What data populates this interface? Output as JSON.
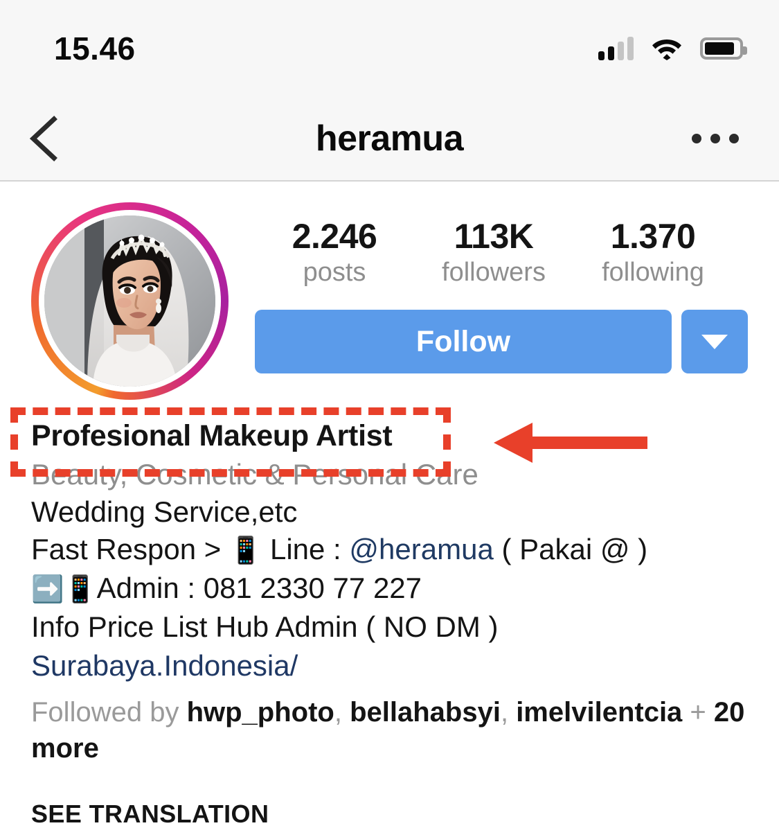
{
  "status_bar": {
    "time": "15.46",
    "signal_icon": "cellular-signal-icon",
    "wifi_icon": "wifi-icon",
    "battery_icon": "battery-icon"
  },
  "nav_bar": {
    "back_icon": "back-chevron-icon",
    "title": "heramua",
    "more_icon": "more-options-icon"
  },
  "profile": {
    "avatar_alt": "profile-picture",
    "stats": [
      {
        "value": "2.246",
        "label": "posts"
      },
      {
        "value": "113K",
        "label": "followers"
      },
      {
        "value": "1.370",
        "label": "following"
      }
    ],
    "follow_label": "Follow",
    "dropdown_icon": "chevron-down-icon"
  },
  "bio": {
    "display_name": "Profesional Makeup Artist",
    "category": "Beauty, Cosmetic & Personal Care",
    "line_wedding": "Wedding Service,etc",
    "line_fast_respon_prefix": "Fast Respon > ",
    "emoji_phone": "📱",
    "line_fast_respon_mid": " Line : ",
    "line_handle": "@heramua",
    "line_fast_respon_suffix": " ( Pakai @ )",
    "emoji_arrow": "➡️",
    "line_admin": "Admin : 081 2330 77 227",
    "line_info": "Info Price List Hub Admin ( NO DM )",
    "url": "Surabaya.Indonesia/",
    "followed_by_prefix": "Followed by ",
    "followed_by_users": [
      "hwp_photo",
      "bellahabsyi",
      "imelvilentcia"
    ],
    "followed_by_separator": ", ",
    "followed_by_suffix_plus": " + ",
    "followed_by_more": "20 more",
    "see_translation": "SEE TRANSLATION"
  },
  "annotation": {
    "highlight_target": "Profesional Makeup Artist",
    "box_color": "#e8402a",
    "arrow_color": "#e8402a",
    "arrow_direction": "left"
  },
  "colors": {
    "follow_button": "#5b9bea",
    "link": "#1f3864",
    "muted_text": "#8e8e8e",
    "status_bar_bg": "#f7f7f7"
  }
}
